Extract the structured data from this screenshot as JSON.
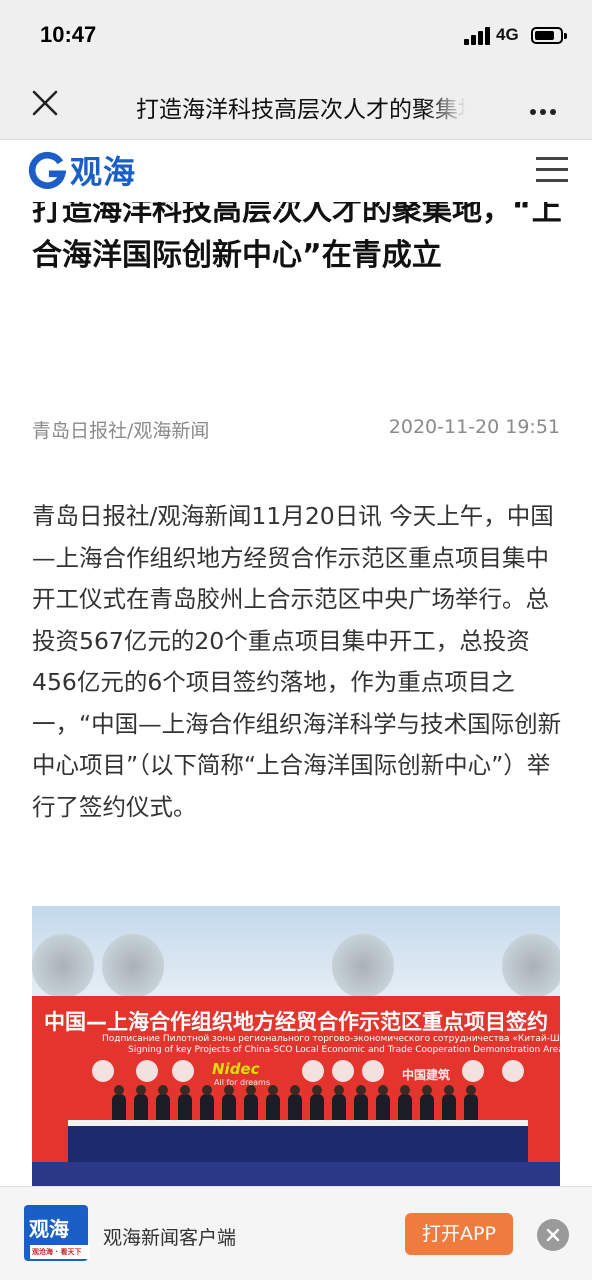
{
  "status_bar": {
    "time": "10:47",
    "network": "4G",
    "battery_level": 0.8
  },
  "nav": {
    "title": "打造海洋科技高层次人才的聚集地，“上合海洋国际创新中心”在青成立"
  },
  "site": {
    "logo_text": "观海"
  },
  "article": {
    "headline": "打造海洋科技高层次人才的聚集地，“上合海洋国际创新中心”在青成立",
    "source": "青岛日报社/观海新闻",
    "date": "2020-11-20 19:51",
    "body": "青岛日报社/观海新闻11月20日讯 今天上午，中国—上海合作组织地方经贸合作示范区重点项目集中开工仪式在青岛胶州上合示范区中央广场举行。总投资567亿元的20个重点项目集中开工，总投资456亿元的6个项目签约落地，作为重点项目之一，“中国—上海合作组织海洋科学与技术国际创新中心项目”（以下简称“上合海洋国际创新中心”）举行了签约仪式。",
    "photo": {
      "backdrop_title": "中国—上海合作组织地方经贸合作示范区重点项目签约",
      "backdrop_russian": "Подписание Пилотной зоны регионального торгово-экономического сотрудничества «Китай-ШОС»",
      "backdrop_english": "Signing of key Projects of China-SCO Local Economic and Trade Cooperation Demonstration Area",
      "sponsor_brand": "Nidec",
      "sponsor_tagline": "All for dreams",
      "sponsor_cn": "中国建筑"
    }
  },
  "ad_bar": {
    "icon_text": "观海",
    "icon_slogan": "观沧海 · 看天下",
    "app_name": "观海新闻客户端",
    "open_label": "打开APP"
  },
  "colors": {
    "brand_blue": "#1b5fc6",
    "open_button": "#f07b3f",
    "backdrop_red": "#e3342e"
  }
}
